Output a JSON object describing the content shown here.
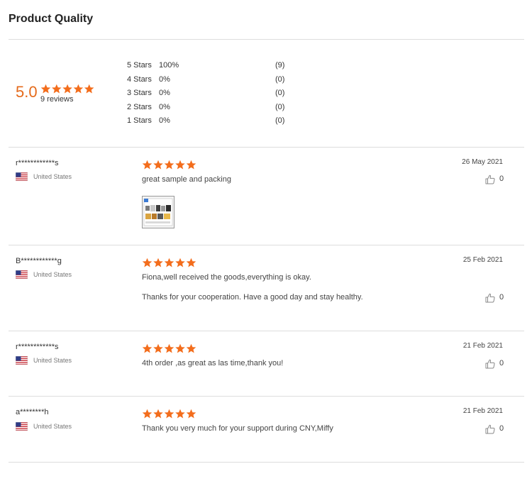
{
  "section_title": "Product Quality",
  "summary": {
    "score": "5.0",
    "reviews": "9 reviews",
    "rating_stars": 5,
    "distribution": [
      {
        "label": "5 Stars",
        "percent": "100%",
        "count": "(9)"
      },
      {
        "label": "4 Stars",
        "percent": "0%",
        "count": "(0)"
      },
      {
        "label": "3 Stars",
        "percent": "0%",
        "count": "(0)"
      },
      {
        "label": "2 Stars",
        "percent": "0%",
        "count": "(0)"
      },
      {
        "label": "1 Stars",
        "percent": "0%",
        "count": "(0)"
      }
    ]
  },
  "colors": {
    "accent": "#f36d1c",
    "divider": "#dddddd"
  },
  "reviews": [
    {
      "reviewer": "r************s",
      "country": "United States",
      "country_flag": "us-flag-icon",
      "stars": 5,
      "date": "26 May 2021",
      "lines": [
        "great sample and packing"
      ],
      "has_photo": true,
      "likes": "0"
    },
    {
      "reviewer": "B************g",
      "country": "United States",
      "country_flag": "us-flag-icon",
      "stars": 5,
      "date": "25 Feb 2021",
      "lines": [
        "Fiona,well received the goods,everything is okay.",
        "Thanks for your cooperation. Have a good day and stay healthy."
      ],
      "has_photo": false,
      "likes": "0"
    },
    {
      "reviewer": "r************s",
      "country": "United States",
      "country_flag": "us-flag-icon",
      "stars": 5,
      "date": "21 Feb 2021",
      "lines": [
        "4th order ,as great as las time,thank you!"
      ],
      "has_photo": false,
      "likes": "0"
    },
    {
      "reviewer": "a********h",
      "country": "United States",
      "country_flag": "us-flag-icon",
      "stars": 5,
      "date": "21 Feb 2021",
      "lines": [
        "Thank you very much for your support during CNY,Miffy"
      ],
      "has_photo": false,
      "likes": "0"
    }
  ]
}
